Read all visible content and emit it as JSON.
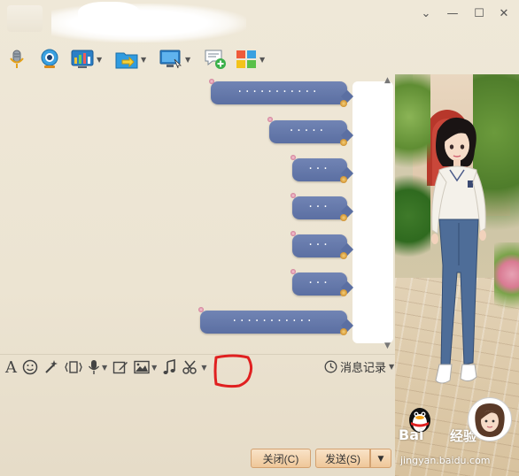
{
  "window": {
    "controls": {
      "minimize": "—",
      "maximize": "☐",
      "close": "✕",
      "menu": "⌄"
    }
  },
  "top_toolbar": [
    {
      "name": "voice-call",
      "icon": "microphone-icon"
    },
    {
      "name": "video-call",
      "icon": "webcam-icon"
    },
    {
      "name": "app-chart",
      "icon": "chart-icon"
    },
    {
      "name": "send-file",
      "icon": "folder-arrow-icon"
    },
    {
      "name": "remote-desktop",
      "icon": "monitor-icon"
    },
    {
      "name": "new-discussion",
      "icon": "chat-add-icon"
    },
    {
      "name": "apps",
      "icon": "apps-grid-icon"
    }
  ],
  "messages": [
    {
      "text": "...........",
      "width": "long"
    },
    {
      "text": ".....",
      "width": "medium"
    },
    {
      "text": "...",
      "width": "short"
    },
    {
      "text": "...",
      "width": "short"
    },
    {
      "text": "...",
      "width": "short"
    },
    {
      "text": "...",
      "width": "short"
    },
    {
      "text": "...........",
      "width": "long"
    }
  ],
  "bottom_toolbar": [
    {
      "name": "font",
      "icon": "font-icon",
      "glyph": "A"
    },
    {
      "name": "emoji",
      "icon": "smiley-icon"
    },
    {
      "name": "magic",
      "icon": "magic-wand-icon"
    },
    {
      "name": "shake",
      "icon": "shake-window-icon"
    },
    {
      "name": "voice-message",
      "icon": "microphone-icon"
    },
    {
      "name": "edit",
      "icon": "pencil-edit-icon"
    },
    {
      "name": "image",
      "icon": "image-icon"
    },
    {
      "name": "music",
      "icon": "music-note-icon"
    },
    {
      "name": "screenshot",
      "icon": "scissors-icon"
    }
  ],
  "history": {
    "label": "消息记录"
  },
  "buttons": {
    "close": "关闭(C)",
    "send": "发送(S)",
    "send_options": "▼"
  },
  "branding": {
    "logo": "Bai",
    "logo_cn": "经验",
    "url": "jingyan.baidu.com"
  },
  "colors": {
    "bubble": "#5b6fa2",
    "highlight": "#e02020",
    "button": "#efc799"
  }
}
